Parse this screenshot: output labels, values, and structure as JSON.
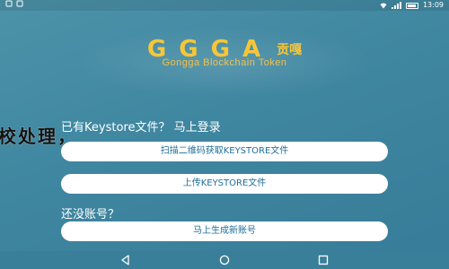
{
  "status_bar": {
    "left_icons": [
      "app-notification-icon",
      "app-notification-icon"
    ],
    "time": "13:09"
  },
  "logo": {
    "title": "GGGA",
    "title_cn": "贡嘎",
    "subtitle": "Gongga Blockchain Token"
  },
  "overlay": {
    "text": "校处理，"
  },
  "import": {
    "label": "已有Keystore文件？ 马上登录",
    "scan_button": "扫描二维码获取KEYSTORE文件",
    "upload_button": "上传KEYSTORE文件"
  },
  "register": {
    "label": "还没账号？",
    "create_button": "马上生成新账号"
  },
  "nav": {
    "icons": [
      "back-icon",
      "home-icon",
      "recent-apps-icon"
    ]
  },
  "colors": {
    "background": "#4a8fa6",
    "logo_gold": "#f7c637",
    "button_text": "#1f6f99"
  }
}
